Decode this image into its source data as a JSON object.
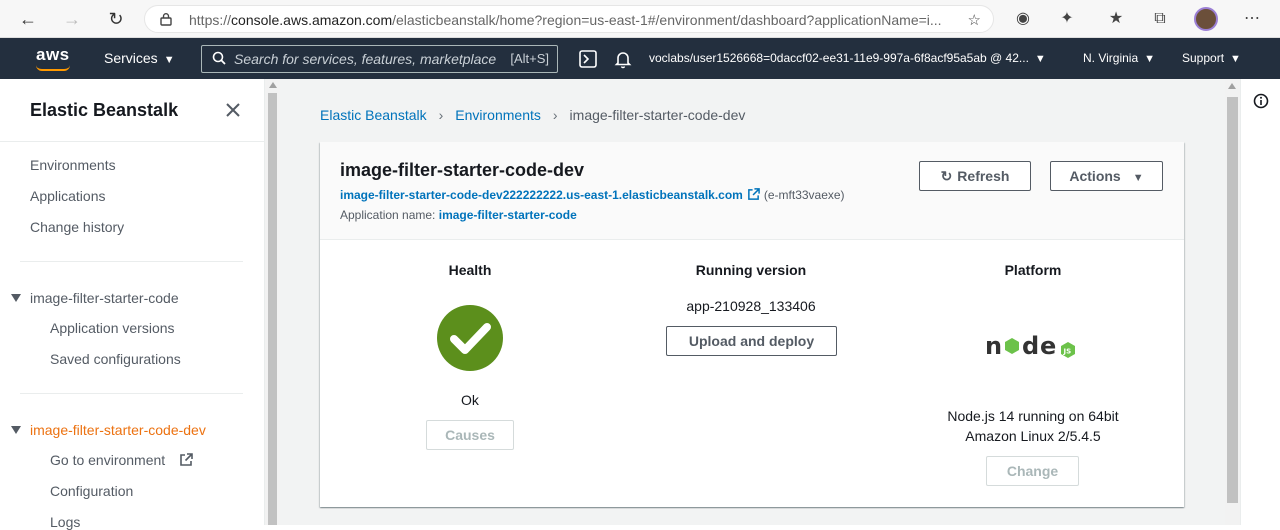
{
  "browser": {
    "url_prefix": "https://",
    "url_host": "console.aws.amazon.com",
    "url_rest": "/elasticbeanstalk/home?region=us-east-1#/environment/dashboard?applicationName=i..."
  },
  "aws_nav": {
    "logo": "aws",
    "services_label": "Services",
    "search_placeholder": "Search for services, features, marketplace",
    "search_shortcut": "[Alt+S]",
    "account": "voclabs/user1526668=0daccf02-ee31-11e9-997a-6f8acf95a5ab @ 42...",
    "region": "N. Virginia",
    "support": "Support"
  },
  "sidebar": {
    "title": "Elastic Beanstalk",
    "links": [
      "Environments",
      "Applications",
      "Change history"
    ],
    "app_group": {
      "name": "image-filter-starter-code",
      "items": [
        "Application versions",
        "Saved configurations"
      ]
    },
    "env_group": {
      "name": "image-filter-starter-code-dev",
      "items": [
        "Go to environment",
        "Configuration",
        "Logs"
      ]
    }
  },
  "breadcrumb": [
    "Elastic Beanstalk",
    "Environments",
    "image-filter-starter-code-dev"
  ],
  "environment": {
    "title": "image-filter-starter-code-dev",
    "url": "image-filter-starter-code-dev222222222.us-east-1.elasticbeanstalk.com",
    "env_id": "(e-mft33vaexe)",
    "app_name_label": "Application name:",
    "app_name": "image-filter-starter-code",
    "refresh_label": "Refresh",
    "actions_label": "Actions"
  },
  "health": {
    "heading": "Health",
    "status": "Ok",
    "causes_label": "Causes"
  },
  "running_version": {
    "heading": "Running version",
    "version": "app-210928_133406",
    "upload_label": "Upload and deploy"
  },
  "platform": {
    "heading": "Platform",
    "logo": "node",
    "line1": "Node.js 14 running on 64bit",
    "line2": "Amazon Linux 2/5.4.5",
    "change_label": "Change"
  },
  "colors": {
    "aws_nav": "#232f3e",
    "link": "#0073bb",
    "active": "#ec7211",
    "health_ok": "#5c8f1c",
    "node_green": "#6cc24a"
  }
}
